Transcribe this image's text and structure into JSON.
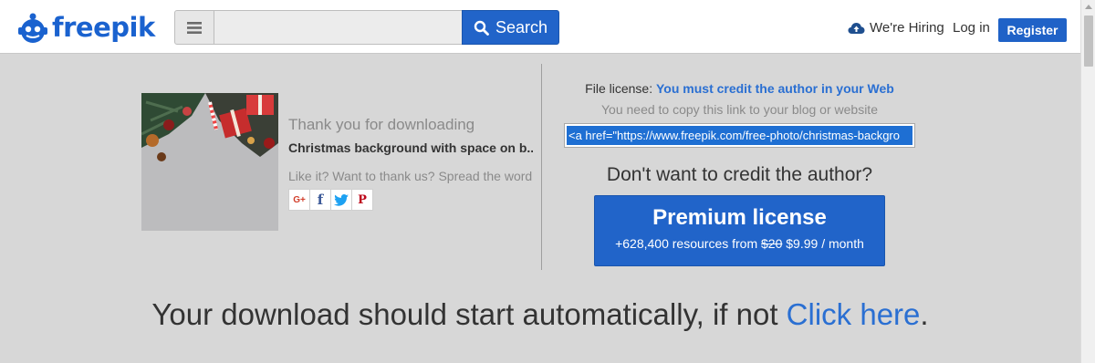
{
  "header": {
    "logo_text": "freepik",
    "search": {
      "placeholder": "",
      "value": "",
      "button_label": "Search"
    },
    "hiring_label": "We're Hiring",
    "login_label": "Log in",
    "register_label": "Register"
  },
  "download": {
    "thanks_text": "Thank you for downloading",
    "resource_title": "Christmas background with space on b...",
    "spread_text": "Like it? Want to thank us? Spread the word",
    "social": [
      "G+",
      "f",
      "twitter",
      "P"
    ]
  },
  "license": {
    "label": "File license:",
    "highlight": "You must credit the author in your Web",
    "copy_note": "You need to copy this link to your blog or website",
    "link_value": "<a href=\"https://www.freepik.com/free-photo/christmas-backgro",
    "dont_credit": "Don't want to credit the author?",
    "premium": {
      "title": "Premium license",
      "resources": "+628,400 resources from",
      "old_price": "$20",
      "new_price": "$9.99 / month"
    }
  },
  "footer_message": {
    "text": "Your download should start automatically, if not",
    "link": "Click here",
    "period": "."
  },
  "colors": {
    "brand_blue": "#2164c9",
    "link_blue": "#2a6fd2",
    "background": "#d7d7d7"
  }
}
